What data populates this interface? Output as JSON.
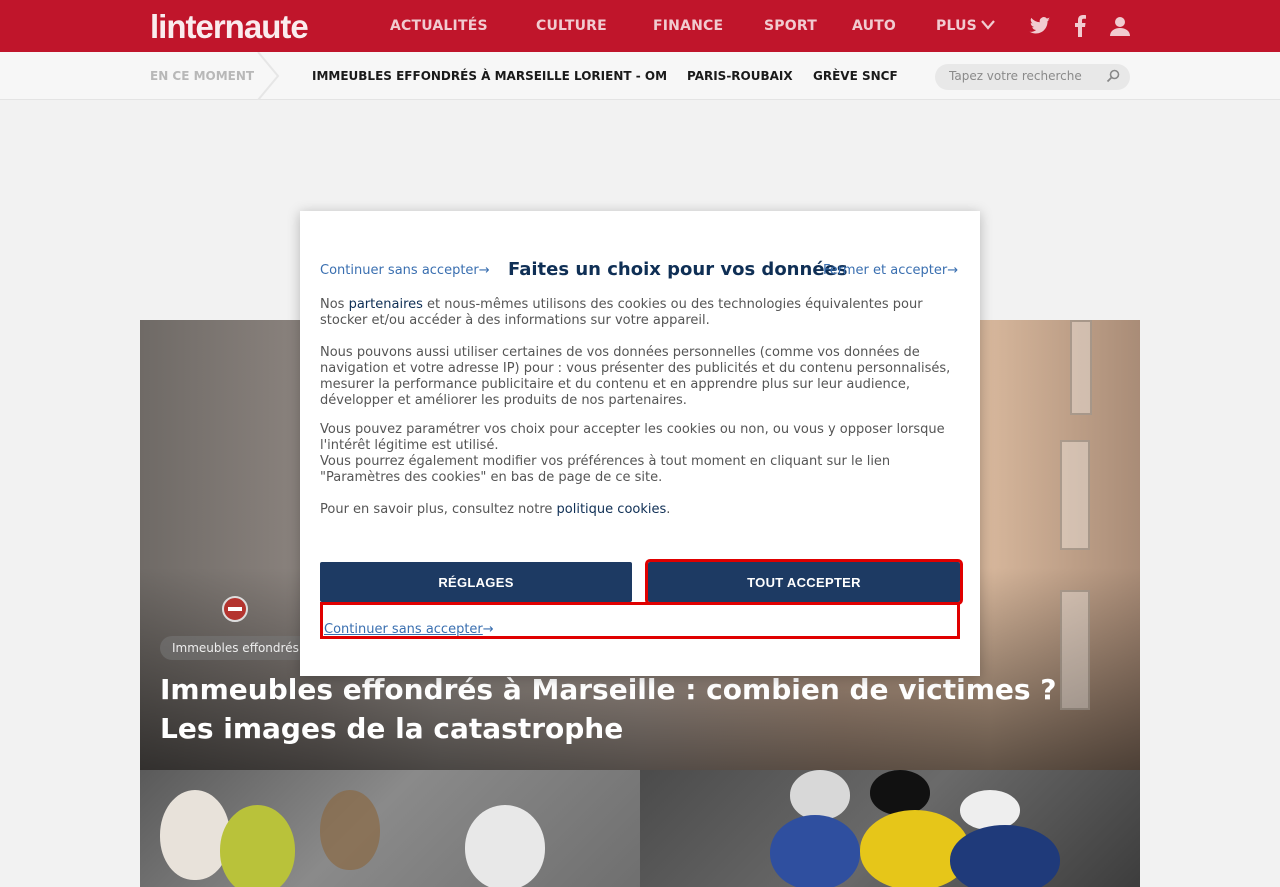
{
  "header": {
    "logo": "linternaute",
    "nav": [
      "ACTUALITÉS",
      "CULTURE",
      "FINANCE",
      "SPORT",
      "AUTO",
      "PLUS"
    ],
    "brand_color": "#c0152b"
  },
  "subnav": {
    "now_label": "EN CE MOMENT",
    "trends": [
      "IMMEUBLES EFFONDRÉS À MARSEILLE",
      "LORIENT - OM",
      "PARIS-ROUBAIX",
      "GRÈVE SNCF"
    ],
    "search_placeholder": "Tapez votre recherche"
  },
  "hero": {
    "tag": "Immeubles effondrés",
    "title_line1": "Immeubles effondrés à Marseille : combien de victimes ?",
    "title_line2": "Les images de la catastrophe"
  },
  "modal": {
    "continue_link": "Continuer sans accepter",
    "title": "Faites un choix pour vos données",
    "close_accept_link": "Fermer et accepter",
    "arrow": "→",
    "p1_prefix": "Nos ",
    "p1_partners": "partenaires",
    "p1_line1_rest": " et nous-mêmes utilisons des cookies ou des technologies équivalentes pour",
    "p1_line2": "stocker et/ou accéder à des informations sur votre appareil.",
    "p2_line1": "Nous pouvons aussi utiliser certaines de vos données personnelles (comme vos données de",
    "p2_line2": "navigation et votre adresse IP) pour : vous présenter des publicités et du contenu personnalisés,",
    "p2_line3": "mesurer la performance publicitaire et du contenu et en apprendre plus sur leur audience,",
    "p2_line4": "développer et améliorer les produits de nos partenaires.",
    "p3_line1": "Vous pouvez paramétrer vos choix pour accepter les cookies ou non, ou vous y opposer lorsque",
    "p3_line2": "l'intérêt légitime est utilisé.",
    "p3_line3": "Vous pourrez également modifier vos préférences à tout moment en cliquant sur le lien",
    "p3_line4": "\"Paramètres des cookies\" en bas de page de ce site.",
    "p4_prefix": "Pour en savoir plus, consultez notre ",
    "p4_link": "politique cookies",
    "p4_suffix": ".",
    "settings_button": "RÉGLAGES",
    "accept_button": "TOUT ACCEPTER",
    "bottom_link": "Continuer sans accepter"
  }
}
